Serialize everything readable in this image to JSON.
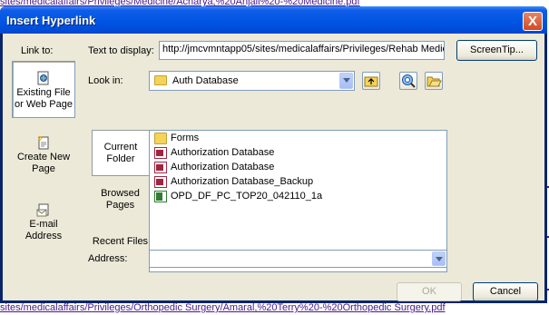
{
  "background": {
    "top_link": "sites/medicalaffairs/Privileges/Medicine/Acharya,%20Anjali%20-%20Medicine.pdf",
    "bottom_link": "sites/medicalaffairs/Privileges/Orthopedic Surgery/Amaral,%20Terry%20-%20Orthopedic Surgery.pdf"
  },
  "dialog": {
    "title": "Insert Hyperlink",
    "close_label": "X"
  },
  "link_to": {
    "label": "Link to:",
    "items": [
      {
        "label": "Existing File or Web Page",
        "icon": "existing-file-icon",
        "active": true
      },
      {
        "label": "Create New Page",
        "icon": "new-page-icon",
        "active": false
      },
      {
        "label": "E-mail Address",
        "icon": "email-icon",
        "active": false
      }
    ]
  },
  "text_to_display": {
    "label": "Text to display:",
    "value": "http://jmcvmntapp05/sites/medicalaffairs/Privileges/Rehab Medic"
  },
  "screentip_label": "ScreenTip...",
  "look_in": {
    "label": "Look in:",
    "value": "Auth Database"
  },
  "tabs": [
    {
      "label": "Current Folder",
      "active": true
    },
    {
      "label": "Browsed Pages",
      "active": false
    },
    {
      "label": "Recent Files",
      "active": false
    }
  ],
  "files": [
    {
      "name": "Forms",
      "type": "folder"
    },
    {
      "name": "Authorization Database",
      "type": "access"
    },
    {
      "name": "Authorization Database",
      "type": "access"
    },
    {
      "name": "Authorization Database_Backup",
      "type": "access"
    },
    {
      "name": "OPD_DF_PC_TOP20_042110_1a",
      "type": "excel"
    }
  ],
  "address": {
    "label": "Address:",
    "value": ""
  },
  "ok_label": "OK",
  "cancel_label": "Cancel",
  "colors": {
    "titlebar": "#0054e3",
    "dialog_face": "#ece9d8",
    "link_text": "#4a1a8c",
    "close_button": "#d04a20"
  }
}
